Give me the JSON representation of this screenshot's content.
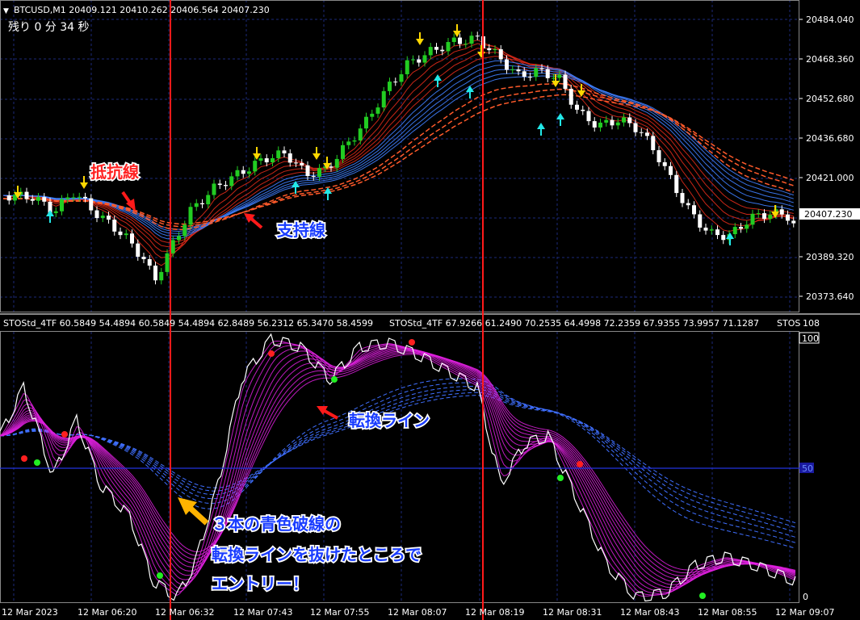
{
  "symbol_line": "BTCUSD,M1  20409.121  20410.262  20406.564  20407.230",
  "timer_line": "残り  0 分  34 秒",
  "main_price_axis": [
    "20484.040",
    "20468.360",
    "20452.680",
    "20436.680",
    "20421.000",
    "20389.320",
    "20373.640"
  ],
  "current_price": "20407.230",
  "indicator_header_1": "STOStd_4TF 60.5849 54.4894 60.5849 54.4894 62.8489 56.2312 65.3470 58.4599",
  "indicator_header_2": "STOStd_4TF 67.9266 61.2490 70.2535 64.4998 72.2359 67.9355 73.9957 71.1287",
  "indicator_header_3": "STOS",
  "indicator_axis_top": "108",
  "indicator_axis_100": "100",
  "indicator_axis_50": "50",
  "indicator_axis_0": "0",
  "time_axis": [
    "12 Mar 2023",
    "12 Mar 06:20",
    "12 Mar 06:32",
    "12 Mar 07:43",
    "12 Mar 07:55",
    "12 Mar 08:07",
    "12 Mar 08:19",
    "12 Mar 08:31",
    "12 Mar 08:43",
    "12 Mar 08:55",
    "12 Mar 09:07"
  ],
  "annotations": {
    "resistance": "抵抗線",
    "support": "支持線",
    "turning_line": "転換ライン",
    "entry_1": "３本の青色破線の",
    "entry_2": "転換ラインを抜けたところで",
    "entry_3": "エントリー！"
  },
  "colors": {
    "background": "#000000",
    "grid": "#1c2a7a",
    "bull": "#22cc22",
    "bear": "#ffffff",
    "red_ribbon": "#dd2a1a",
    "blue_ribbon": "#3f7fff",
    "magenta": "#e020e0",
    "vertical_line": "#ff1a1a",
    "up_arrow": "#22e8e8",
    "down_arrow": "#ffd700"
  }
}
